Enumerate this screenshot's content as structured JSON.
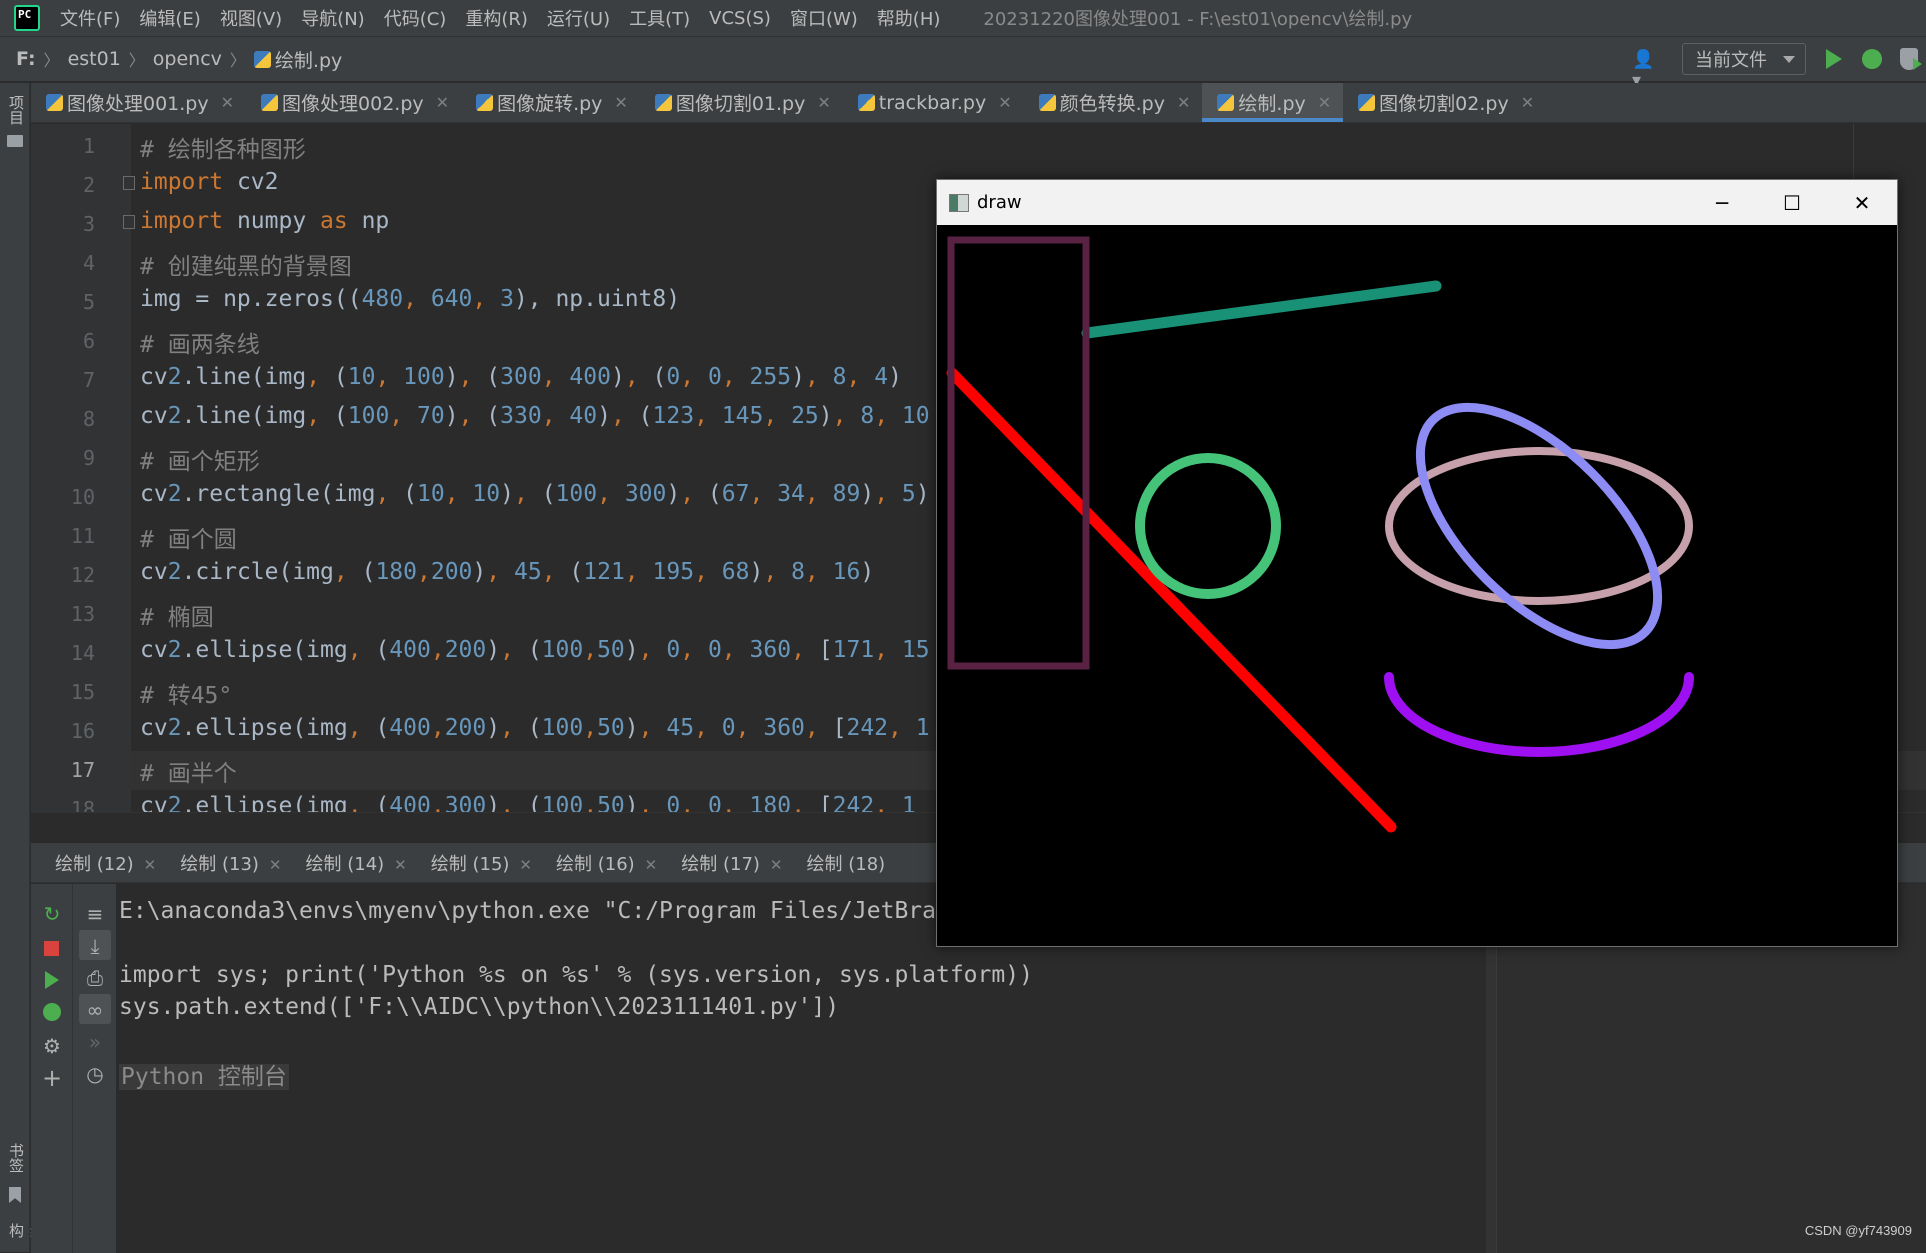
{
  "menubar": {
    "items": [
      "文件(F)",
      "编辑(E)",
      "视图(V)",
      "导航(N)",
      "代码(C)",
      "重构(R)",
      "运行(U)",
      "工具(T)",
      "VCS(S)",
      "窗口(W)",
      "帮助(H)"
    ],
    "window_title": "20231220图像处理001 - F:\\est01\\opencv\\绘制.py",
    "logo_text": "PC"
  },
  "navbar": {
    "breadcrumbs": [
      "F:",
      "est01",
      "opencv",
      "绘制.py"
    ],
    "run_config": "当前文件",
    "icons": [
      "user-icon",
      "run-icon",
      "debug-icon",
      "coverage-icon"
    ]
  },
  "left_strip": {
    "top_label": "项目",
    "bottom_label_1": "书签",
    "bottom_label_2": "结构"
  },
  "tabs": [
    {
      "label": "图像处理001.py",
      "active": false
    },
    {
      "label": "图像处理002.py",
      "active": false
    },
    {
      "label": "图像旋转.py",
      "active": false
    },
    {
      "label": "图像切割01.py",
      "active": false
    },
    {
      "label": "trackbar.py",
      "active": false
    },
    {
      "label": "颜色转换.py",
      "active": false
    },
    {
      "label": "绘制.py",
      "active": true
    },
    {
      "label": "图像切割02.py",
      "active": false
    }
  ],
  "editor": {
    "current_line": 17,
    "lines": [
      "1",
      "2",
      "3",
      "4",
      "5",
      "6",
      "7",
      "8",
      "9",
      "10",
      "11",
      "12",
      "13",
      "14",
      "15",
      "16",
      "17",
      "18"
    ],
    "code": {
      "l1": "# 绘制各种图形",
      "l2_kw": "import",
      "l2_rest": " cv2",
      "l3_kw": "import",
      "l3_mid": " numpy ",
      "l3_as": "as",
      "l3_rest": " np",
      "l4": "# 创建纯黑的背景图",
      "l5_a": "img = np.zeros((",
      "l5_n1": "480",
      "l5_c1": ", ",
      "l5_n2": "640",
      "l5_c2": ", ",
      "l5_n3": "3",
      "l5_b": "), np.uint8)",
      "l6": "# 画两条线",
      "l7": "cv2.line(img, (10, 100), (300, 400), (0, 0, 255), 8, 4)",
      "l8": "cv2.line(img, (100, 70), (330, 40), (123, 145, 25), 8, 10",
      "l9": "# 画个矩形",
      "l10": "cv2.rectangle(img, (10, 10), (100, 300), (67, 34, 89), 5)",
      "l11": "# 画个圆",
      "l12": "cv2.circle(img, (180,200), 45, (121, 195, 68), 8, 16)",
      "l13": "# 椭圆",
      "l14": "cv2.ellipse(img, (400,200), (100,50), 0, 0, 360, [171, 15",
      "l15": "# 转45°",
      "l16": "cv2.ellipse(img, (400,200), (100,50), 45, 0, 360, [242, 1",
      "l17": "# 画半个",
      "l18": "cv2.ellipse(img, (400,300), (100,50), 0, 0, 180, [242, 1"
    }
  },
  "run_panel": {
    "tabs": [
      "绘制 (12)",
      "绘制 (13)",
      "绘制 (14)",
      "绘制 (15)",
      "绘制 (16)",
      "绘制 (17)",
      "绘制 (18)"
    ],
    "console": {
      "line1": "E:\\anaconda3\\envs\\myenv\\python.exe \"C:/Program Files/JetBra",
      "line2": "import sys; print('Python %s on %s' % (sys.version, sys.platform))",
      "line3": "sys.path.extend(['F:\\\\AIDC\\\\python\\\\2023111401.py'])",
      "prompt": "Python 控制台"
    }
  },
  "draw_window": {
    "title": "draw",
    "controls": [
      "minimize-icon",
      "maximize-icon",
      "close-icon"
    ]
  },
  "watermark": "CSDN @yf743909",
  "colors": {
    "accent": "#4a88c7",
    "run_green": "#4cae4f",
    "line_red": "#ff0000",
    "line_teal": "#199177",
    "rect": "#592243",
    "circle": "#44c379",
    "ellipse_pink": "#c6a0ab",
    "ellipse_blue": "#8d8bf4",
    "half_ellipse": "#9e10f2"
  }
}
